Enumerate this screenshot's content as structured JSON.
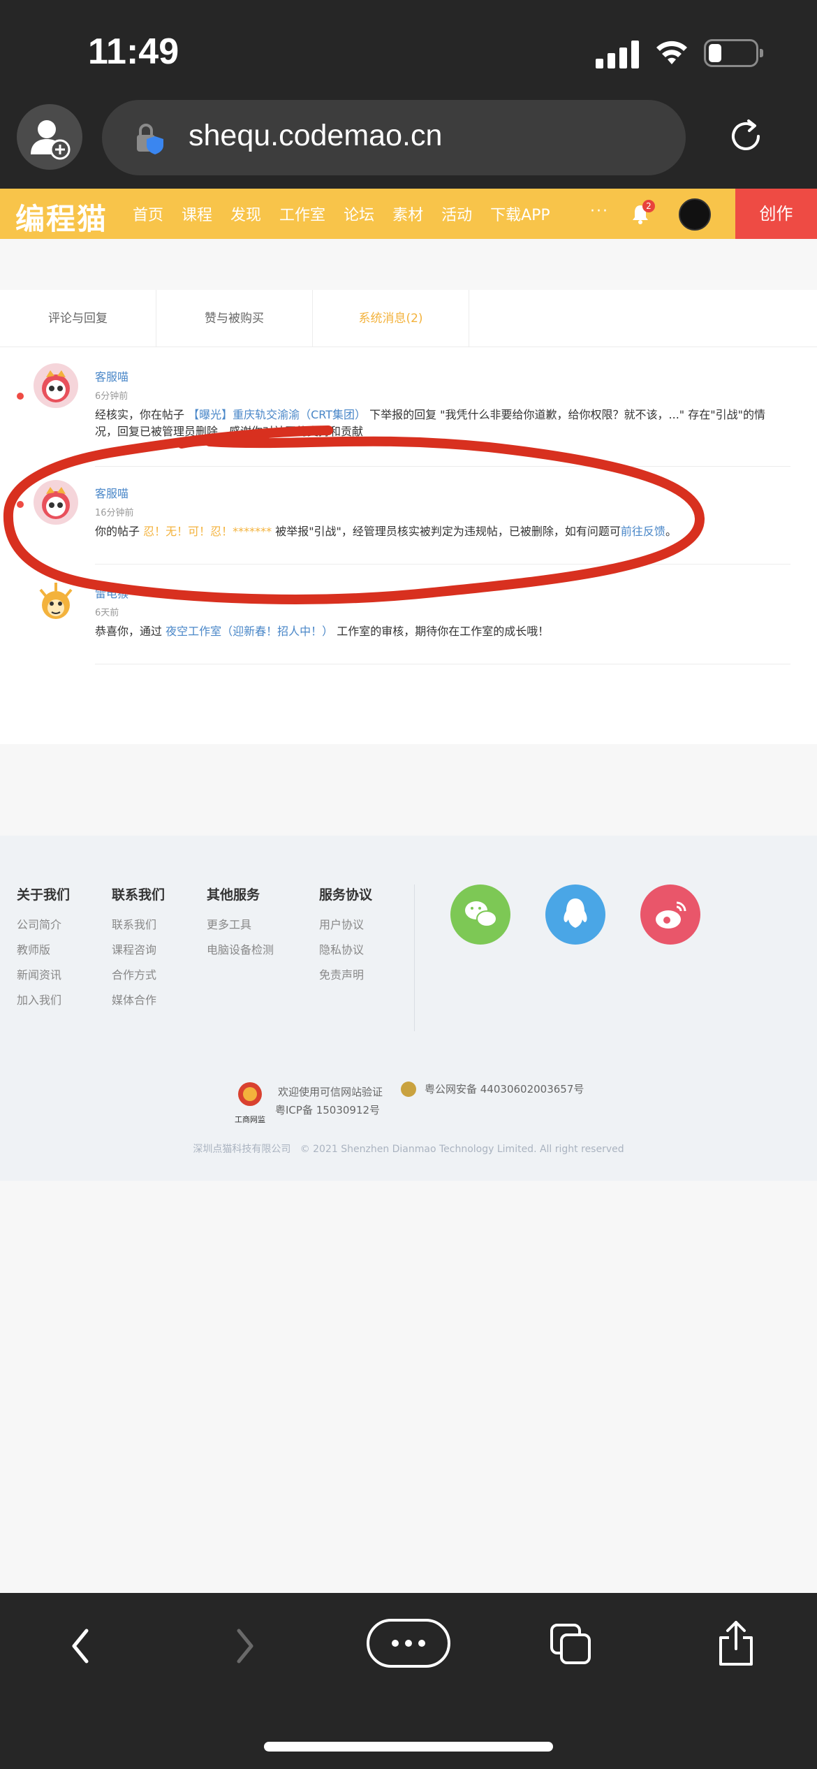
{
  "status_bar": {
    "time": "11:49"
  },
  "browser": {
    "url": "shequ.codemao.cn",
    "icons": [
      "add-profile-icon",
      "shield-lock-icon",
      "reload-icon"
    ]
  },
  "site_nav": {
    "logo": "编程猫",
    "items": [
      "首页",
      "课程",
      "发现",
      "工作室",
      "论坛",
      "素材",
      "活动",
      "下载APP"
    ],
    "more": "···",
    "notification_count": "2",
    "create_label": "创作",
    "accent": "#f8c44a",
    "create_color": "#ee4b44"
  },
  "tabs": [
    {
      "label": "评论与回复"
    },
    {
      "label": "赞与被购买"
    },
    {
      "label": "系统消息(2)"
    }
  ],
  "messages": [
    {
      "name": "客服喵",
      "time": "6分钟前",
      "p1": "经核实，你在帖子 ",
      "link1": "【曝光】重庆轨交渝渝（CRT集团）",
      "p2": " 下举报的回复 \"我凭什么非要给你道歉，给你权限？就不该，...\" 存在\"引战\"的情况，回复已被管理员删除，感谢你对社区的支持和贡献"
    },
    {
      "name": "客服喵",
      "time": "16分钟前",
      "p1": "你的帖子 ",
      "highlight": "忍！无！可！忍！*******",
      "p2": " 被举报\"引战\"，经管理员核实被判定为违规帖，已被删除，如有问题可",
      "link": "前往反馈",
      "p3": "。"
    },
    {
      "name": "雷电猴",
      "time": "6天前",
      "p1": "恭喜你，通过 ",
      "link": "夜空工作室（迎新春！招人中！）",
      "p2": " 工作室的审核，期待你在工作室的成长哦！"
    }
  ],
  "footer": {
    "columns": [
      {
        "title": "关于我们",
        "links": [
          "公司简介",
          "教师版",
          "新闻资讯",
          "加入我们"
        ]
      },
      {
        "title": "联系我们",
        "links": [
          "联系我们",
          "课程咨询",
          "合作方式",
          "媒体合作"
        ]
      },
      {
        "title": "其他服务",
        "links": [
          "更多工具",
          "电脑设备检测"
        ]
      },
      {
        "title": "服务协议",
        "links": [
          "用户协议",
          "隐私协议",
          "免责声明"
        ]
      }
    ],
    "social": [
      {
        "name": "wechat-icon",
        "color": "#7dc855"
      },
      {
        "name": "qq-icon",
        "color": "#4aa6e6"
      },
      {
        "name": "weibo-icon",
        "color": "#e9566a"
      }
    ],
    "verify_text": "欢迎使用可信网站验证",
    "icp": "粤ICP备 15030912号",
    "police": "粤公网安备 44030602003657号",
    "company": "深圳点猫科技有限公司",
    "copyright": "© 2021 Shenzhen Dianmao Technology Limited. All right reserved",
    "seal_caption": "工商网监"
  },
  "browser_toolbar": {
    "icons": [
      "back-icon",
      "forward-icon",
      "more-icon",
      "tabs-icon",
      "share-icon"
    ]
  }
}
